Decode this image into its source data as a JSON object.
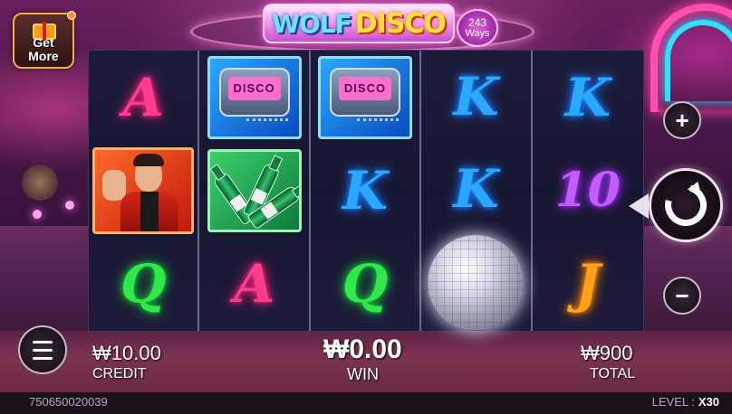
{
  "game": {
    "logo_part1": "WOLF",
    "logo_part2": "DISCO",
    "ways_number": "243",
    "ways_label": "Ways"
  },
  "get_more": {
    "line1": "Get",
    "line2": "More"
  },
  "reels": [
    [
      "A",
      "wild-man",
      "Q"
    ],
    [
      "disco-pager",
      "beer-bottles",
      "A"
    ],
    [
      "disco-pager",
      "K",
      "Q"
    ],
    [
      "K",
      "K",
      "disco-ball"
    ],
    [
      "K",
      "10",
      "J"
    ]
  ],
  "pager_screen_text": "DISCO",
  "controls": {
    "plus_icon": "plus-icon",
    "minus_icon": "minus-icon",
    "spin_icon": "spin-icon",
    "menu_icon": "menu-icon"
  },
  "hud": {
    "credit_value": "₩10.00",
    "credit_label": "CREDIT",
    "win_value": "₩0.00",
    "win_label": "WIN",
    "total_value": "₩900",
    "total_label": "TOTAL"
  },
  "footer": {
    "session_id": "750650020039",
    "level_label": "LEVEL :",
    "level_value": "X30"
  },
  "colors": {
    "A": "#ff3d8a",
    "K": "#2aa8ff",
    "Q": "#2fe84a",
    "J": "#ffa21a",
    "10": "#c45cff"
  }
}
